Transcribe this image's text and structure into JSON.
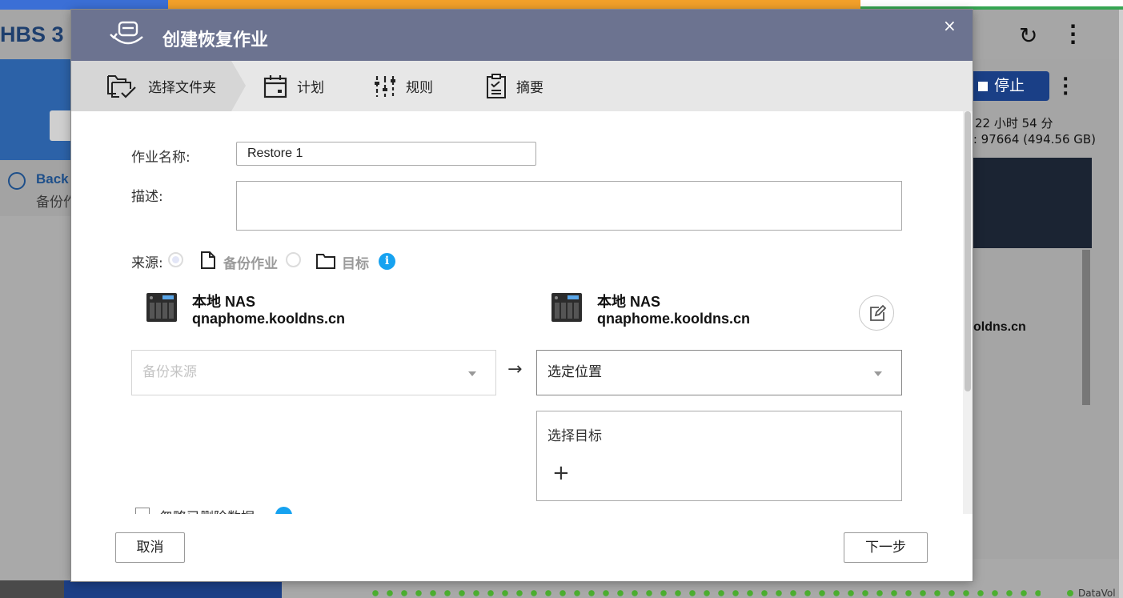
{
  "background": {
    "app_title": "HBS 3",
    "stop_label": "停止",
    "time_remaining": "22 小时 54 分",
    "size_text": "): 97664 (494.56 GB)",
    "backup_link": "Back",
    "backup_sub": "备份作",
    "host_fragment": "oldns.cn",
    "datavol": "DataVol"
  },
  "dialog": {
    "title": "创建恢复作业",
    "close_glyph": "×",
    "steps": [
      {
        "label": "选择文件夹",
        "icon": "folder-check-icon"
      },
      {
        "label": "计划",
        "icon": "calendar-icon"
      },
      {
        "label": "规则",
        "icon": "sliders-icon"
      },
      {
        "label": "摘要",
        "icon": "clipboard-icon"
      }
    ],
    "job_name_label": "作业名称:",
    "job_name_value": "Restore 1",
    "description_label": "描述:",
    "source_label": "来源:",
    "source_options": [
      "备份作业",
      "目标"
    ],
    "left_nas": {
      "name": "本地 NAS",
      "host": "qnaphome.kooldns.cn"
    },
    "right_nas": {
      "name": "本地 NAS",
      "host": "qnaphome.kooldns.cn"
    },
    "source_select_placeholder": "备份来源",
    "arrow": "→",
    "location_select_value": "选定位置",
    "target_box_title": "选择目标",
    "add_glyph": "+",
    "ignore_deleted_label": "忽略已删除数据",
    "cancel_label": "取消",
    "next_label": "下一步",
    "colors": {
      "title_bar": "#6c7390",
      "info": "#16a2f0",
      "step_bar": "#e7e7e7"
    }
  }
}
